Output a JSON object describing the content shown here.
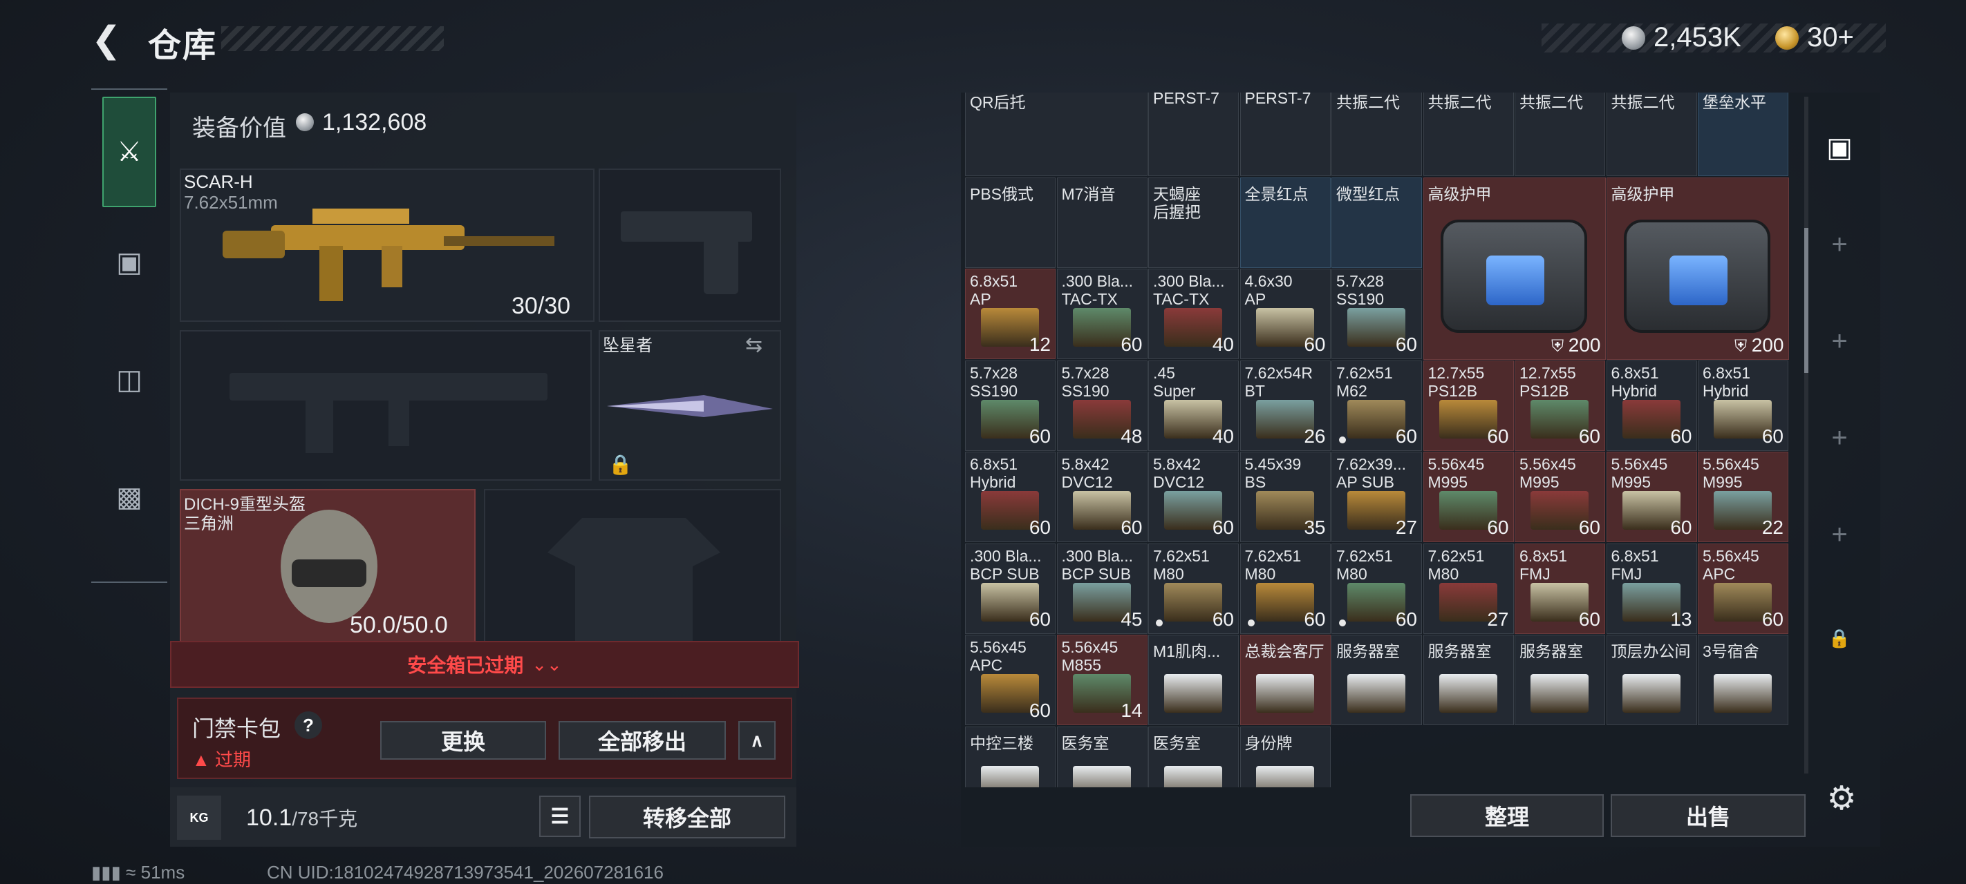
{
  "header": {
    "title": "仓库",
    "back_icon": "back-arrow-icon",
    "currency1": "2,453K",
    "currency2": "30+"
  },
  "tabs": [
    {
      "icon": "pistol-icon"
    },
    {
      "icon": "backpack-icon"
    },
    {
      "icon": "vest-icon"
    },
    {
      "icon": "briefcase-icon"
    }
  ],
  "loadout": {
    "value_label": "装备价值",
    "value": "1,132,608",
    "scar": {
      "name": "SCAR-H",
      "caliber": "7.62x51mm",
      "ammo": "30/30"
    },
    "melee": {
      "name": "坠星者"
    },
    "helmet": {
      "name": "DICH-9重型头盔",
      "map": "三角洲",
      "durability": "50.0/50.0"
    },
    "safe_box": "安全箱已过期",
    "card": {
      "label": "门禁卡包",
      "help": "?",
      "warning": "过期",
      "replace": "更换",
      "remove_all": "全部移出",
      "up": "∧"
    },
    "weight": {
      "value": "10.1",
      "max": "/78千克",
      "kg_icon": "KG",
      "transfer": "转移全部"
    }
  },
  "status": {
    "ping": "51ms",
    "uid": "CN UID:18102474928713973541_202607281616"
  },
  "actions": {
    "sort": "整理",
    "sell": "出售"
  },
  "colors": {
    "expired_red": "#ff4a4a",
    "active_tab": "#1f4d3a",
    "cell_red": "#4e2a2c"
  },
  "grid": {
    "row0": [
      {
        "t1": "QR后托",
        "t2": "",
        "q": "",
        "w": 2
      },
      {
        "t1": "PERST-7",
        "t2": "",
        "q": ""
      },
      {
        "t1": "PERST-7",
        "t2": "",
        "q": ""
      },
      {
        "t1": "共振二代",
        "t2": "",
        "q": ""
      },
      {
        "t1": "共振二代",
        "t2": "",
        "q": ""
      },
      {
        "t1": "共振二代",
        "t2": "",
        "q": ""
      },
      {
        "t1": "共振二代",
        "t2": "",
        "q": ""
      },
      {
        "t1": "堡垒水平",
        "t2": "",
        "q": ""
      }
    ],
    "row1": [
      {
        "t1": "PBS俄式",
        "t2": "",
        "q": ""
      },
      {
        "t1": "M7消音",
        "t2": "",
        "q": ""
      },
      {
        "t1": "天蝎座",
        "t2": "后握把",
        "q": ""
      },
      {
        "t1": "全景红点",
        "t2": "",
        "q": ""
      },
      {
        "t1": "微型红点",
        "t2": "",
        "q": ""
      }
    ],
    "armor1": {
      "t1": "高级护甲",
      "q": "200"
    },
    "armor2": {
      "t1": "高级护甲",
      "q": "200"
    },
    "row2": [
      {
        "t1": "6.8x51",
        "t2": "AP",
        "q": "12"
      },
      {
        "t1": ".300 Bla...",
        "t2": "TAC-TX",
        "q": "60"
      },
      {
        "t1": ".300 Bla...",
        "t2": "TAC-TX",
        "q": "40"
      },
      {
        "t1": "4.6x30",
        "t2": "AP",
        "q": "60"
      },
      {
        "t1": "5.7x28",
        "t2": "SS190",
        "q": "60"
      }
    ],
    "row3": [
      {
        "t1": "5.7x28",
        "t2": "SS190",
        "q": "60"
      },
      {
        "t1": "5.7x28",
        "t2": "SS190",
        "q": "48"
      },
      {
        "t1": ".45",
        "t2": "Super",
        "q": "40"
      },
      {
        "t1": "7.62x54R",
        "t2": "BT",
        "q": "26"
      },
      {
        "t1": "7.62x51",
        "t2": "M62",
        "q": "60"
      },
      {
        "t1": "12.7x55",
        "t2": "PS12B",
        "q": "60"
      },
      {
        "t1": "12.7x55",
        "t2": "PS12B",
        "q": "60"
      },
      {
        "t1": "6.8x51",
        "t2": "Hybrid",
        "q": "60"
      },
      {
        "t1": "6.8x51",
        "t2": "Hybrid",
        "q": "60"
      }
    ],
    "row4": [
      {
        "t1": "6.8x51",
        "t2": "Hybrid",
        "q": "60"
      },
      {
        "t1": "5.8x42",
        "t2": "DVC12",
        "q": "60"
      },
      {
        "t1": "5.8x42",
        "t2": "DVC12",
        "q": "60"
      },
      {
        "t1": "5.45x39",
        "t2": "BS",
        "q": "35"
      },
      {
        "t1": "7.62x39...",
        "t2": "AP SUB",
        "q": "27"
      },
      {
        "t1": "5.56x45",
        "t2": "M995",
        "q": "60"
      },
      {
        "t1": "5.56x45",
        "t2": "M995",
        "q": "60"
      },
      {
        "t1": "5.56x45",
        "t2": "M995",
        "q": "60"
      },
      {
        "t1": "5.56x45",
        "t2": "M995",
        "q": "22"
      }
    ],
    "row5": [
      {
        "t1": ".300 Bla...",
        "t2": "BCP SUB",
        "q": "60"
      },
      {
        "t1": ".300 Bla...",
        "t2": "BCP SUB",
        "q": "45"
      },
      {
        "t1": "7.62x51",
        "t2": "M80",
        "q": "60"
      },
      {
        "t1": "7.62x51",
        "t2": "M80",
        "q": "60"
      },
      {
        "t1": "7.62x51",
        "t2": "M80",
        "q": "60"
      },
      {
        "t1": "7.62x51",
        "t2": "M80",
        "q": "27"
      },
      {
        "t1": "6.8x51",
        "t2": "FMJ",
        "q": "60"
      },
      {
        "t1": "6.8x51",
        "t2": "FMJ",
        "q": "13"
      },
      {
        "t1": "5.56x45",
        "t2": "APC",
        "q": "60"
      }
    ],
    "row6": [
      {
        "t1": "5.56x45",
        "t2": "APC",
        "q": "60"
      },
      {
        "t1": "5.56x45",
        "t2": "M855",
        "q": "14"
      },
      {
        "t1": "M1肌肉...",
        "t2": "",
        "q": ""
      },
      {
        "t1": "总裁会客厅",
        "t2": "",
        "q": ""
      },
      {
        "t1": "服务器室",
        "t2": "",
        "q": ""
      },
      {
        "t1": "服务器室",
        "t2": "",
        "q": ""
      },
      {
        "t1": "服务器室",
        "t2": "",
        "q": ""
      },
      {
        "t1": "顶层办公间",
        "t2": "",
        "q": ""
      },
      {
        "t1": "3号宿舍",
        "t2": "",
        "q": ""
      }
    ],
    "row7": [
      {
        "t1": "中控三楼",
        "t2": "",
        "q": ""
      },
      {
        "t1": "医务室",
        "t2": "",
        "q": ""
      },
      {
        "t1": "医务室",
        "t2": "",
        "q": ""
      },
      {
        "t1": "身份牌",
        "t2": "",
        "q": ""
      }
    ]
  }
}
